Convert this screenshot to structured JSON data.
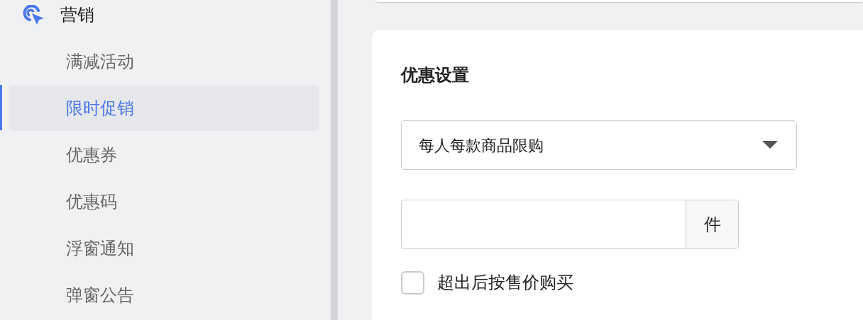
{
  "sidebar": {
    "group": {
      "label": "营销"
    },
    "items": [
      {
        "label": "满减活动",
        "selected": false
      },
      {
        "label": "限时促销",
        "selected": true
      },
      {
        "label": "优惠券",
        "selected": false
      },
      {
        "label": "优惠码",
        "selected": false
      },
      {
        "label": "浮窗通知",
        "selected": false
      },
      {
        "label": "弹窗公告",
        "selected": false
      }
    ]
  },
  "card": {
    "title": "优惠设置",
    "select": {
      "value": "每人每款商品限购"
    },
    "quantity": {
      "suffix": "件"
    },
    "checkbox": {
      "label": "超出后按售价购买",
      "checked": false
    }
  }
}
